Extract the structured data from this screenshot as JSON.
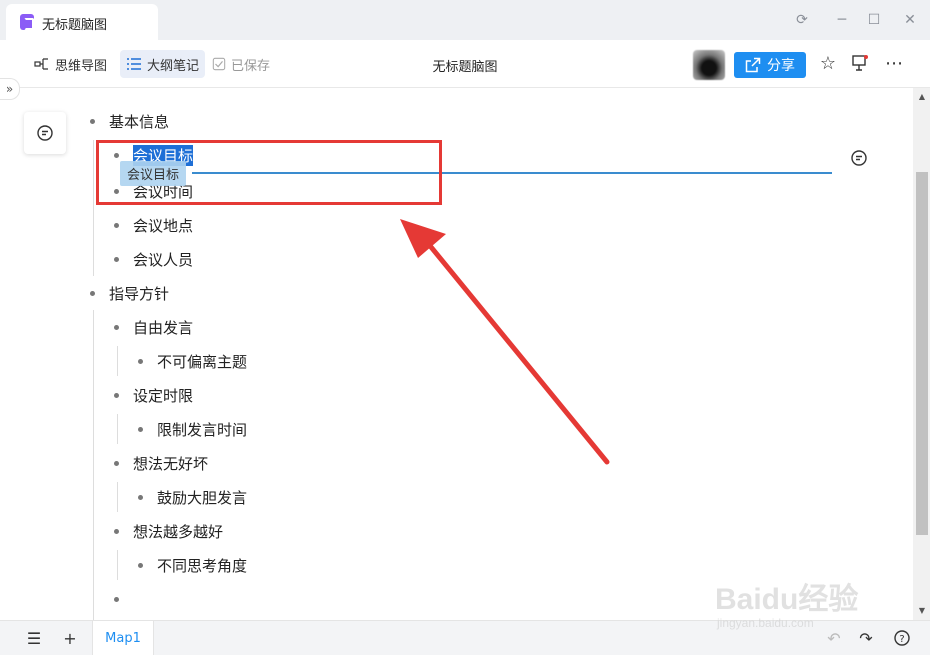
{
  "window": {
    "tab_title": "无标题脑图",
    "controls": [
      "sync-icon",
      "minimize-icon",
      "maximize-icon",
      "close-icon"
    ]
  },
  "toolbar": {
    "mindmap_label": "思维导图",
    "outline_label": "大纲笔记",
    "saved_label": "已保存",
    "doc_title": "无标题脑图",
    "share_label": "分享",
    "accent_color": "#1e8ef1"
  },
  "outline": {
    "items": [
      {
        "text": "基本信息",
        "level": 0
      },
      {
        "text": "会议目标",
        "level": 1,
        "selected": true
      },
      {
        "text": "会议时间",
        "level": 1
      },
      {
        "text": "会议地点",
        "level": 1
      },
      {
        "text": "会议人员",
        "level": 1
      },
      {
        "text": "指导方针",
        "level": 0
      },
      {
        "text": "自由发言",
        "level": 1
      },
      {
        "text": "不可偏离主题",
        "level": 2
      },
      {
        "text": "设定时限",
        "level": 1
      },
      {
        "text": "限制发言时间",
        "level": 2
      },
      {
        "text": "想法无好坏",
        "level": 1
      },
      {
        "text": "鼓励大胆发言",
        "level": 2
      },
      {
        "text": "想法越多越好",
        "level": 1
      },
      {
        "text": "不同思考角度",
        "level": 2
      },
      {
        "text": "",
        "level": 1
      }
    ],
    "drag_ghost_text": "会议目标"
  },
  "annotation": {
    "highlight_color": "#e53935"
  },
  "bottombar": {
    "sheet_tab": "Map1"
  },
  "watermark": {
    "brand": "Baidu经验",
    "url": "jingyan.baidu.com"
  }
}
